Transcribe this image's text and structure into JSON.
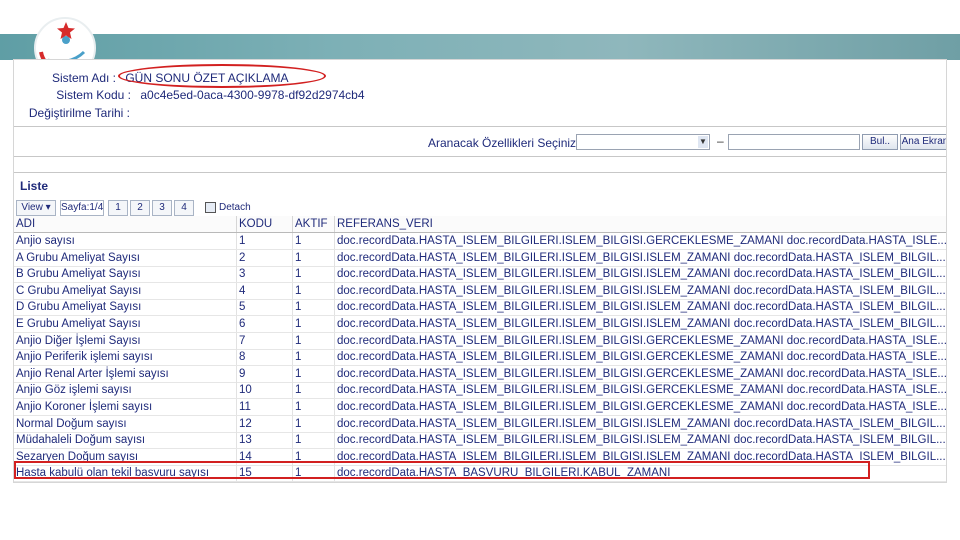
{
  "meta": {
    "system_name_label": "Sistem Adı :",
    "system_name_value": "GÜN SONU ÖZET AÇIKLAMA",
    "system_code_label": "Sistem Kodu :",
    "system_code_value": "a0c4e5ed-0aca-4300-9978-df92d2974cb4",
    "modified_date_label": "Değiştirilme Tarihi :"
  },
  "search": {
    "label": "Aranacak Özellikleri Seçiniz",
    "dash": "–",
    "find_button": "Bul..",
    "main_screen_button": "Ana Ekran"
  },
  "list": {
    "title": "Liste",
    "view_label": "View ▾",
    "page_label": "Sayfa:1/4",
    "pages": [
      "1",
      "2",
      "3",
      "4"
    ],
    "detach_label": "Detach"
  },
  "table": {
    "headers": [
      "ADI",
      "KODU",
      "AKTIF",
      "REFERANS_VERI"
    ],
    "rows": [
      [
        "Anjio sayısı",
        "1",
        "1",
        "doc.recordData.HASTA_ISLEM_BILGILERI.ISLEM_BILGISI.GERCEKLESME_ZAMANI doc.recordData.HASTA_ISLE..."
      ],
      [
        "A Grubu Ameliyat Sayısı",
        "2",
        "1",
        "doc.recordData.HASTA_ISLEM_BILGILERI.ISLEM_BILGISI.ISLEM_ZAMANI doc.recordData.HASTA_ISLEM_BILGIL..."
      ],
      [
        "B Grubu Ameliyat Sayısı",
        "3",
        "1",
        "doc.recordData.HASTA_ISLEM_BILGILERI.ISLEM_BILGISI.ISLEM_ZAMANI doc.recordData.HASTA_ISLEM_BILGIL..."
      ],
      [
        "C Grubu Ameliyat Sayısı",
        "4",
        "1",
        "doc.recordData.HASTA_ISLEM_BILGILERI.ISLEM_BILGISI.ISLEM_ZAMANI doc.recordData.HASTA_ISLEM_BILGIL..."
      ],
      [
        "D Grubu Ameliyat Sayısı",
        "5",
        "1",
        "doc.recordData.HASTA_ISLEM_BILGILERI.ISLEM_BILGISI.ISLEM_ZAMANI doc.recordData.HASTA_ISLEM_BILGIL..."
      ],
      [
        "E Grubu Ameliyat Sayısı",
        "6",
        "1",
        "doc.recordData.HASTA_ISLEM_BILGILERI.ISLEM_BILGISI.ISLEM_ZAMANI doc.recordData.HASTA_ISLEM_BILGIL..."
      ],
      [
        "Anjio Diğer İşlemi Sayısı",
        "7",
        "1",
        "doc.recordData.HASTA_ISLEM_BILGILERI.ISLEM_BILGISI.GERCEKLESME_ZAMANI doc.recordData.HASTA_ISLE..."
      ],
      [
        "Anjio Periferik işlemi sayısı",
        "8",
        "1",
        "doc.recordData.HASTA_ISLEM_BILGILERI.ISLEM_BILGISI.GERCEKLESME_ZAMANI doc.recordData.HASTA_ISLE..."
      ],
      [
        "Anjio Renal Arter İşlemi sayısı",
        "9",
        "1",
        "doc.recordData.HASTA_ISLEM_BILGILERI.ISLEM_BILGISI.GERCEKLESME_ZAMANI doc.recordData.HASTA_ISLE..."
      ],
      [
        "Anjio Göz işlemi sayısı",
        "10",
        "1",
        "doc.recordData.HASTA_ISLEM_BILGILERI.ISLEM_BILGISI.GERCEKLESME_ZAMANI doc.recordData.HASTA_ISLE..."
      ],
      [
        "Anjio Koroner İşlemi sayısı",
        "11",
        "1",
        "doc.recordData.HASTA_ISLEM_BILGILERI.ISLEM_BILGISI.GERCEKLESME_ZAMANI doc.recordData.HASTA_ISLE..."
      ],
      [
        "Normal Doğum sayısı",
        "12",
        "1",
        "doc.recordData.HASTA_ISLEM_BILGILERI.ISLEM_BILGISI.ISLEM_ZAMANI doc.recordData.HASTA_ISLEM_BILGIL..."
      ],
      [
        "Müdahaleli Doğum sayısı",
        "13",
        "1",
        "doc.recordData.HASTA_ISLEM_BILGILERI.ISLEM_BILGISI.ISLEM_ZAMANI doc.recordData.HASTA_ISLEM_BILGIL..."
      ],
      [
        "Sezaryen Doğum sayısı",
        "14",
        "1",
        "doc.recordData.HASTA_ISLEM_BILGILERI.ISLEM_BILGISI.ISLEM_ZAMANI doc.recordData.HASTA_ISLEM_BILGIL..."
      ],
      [
        "Hasta kabulü olan tekil basvuru sayısı",
        "15",
        "1",
        "doc.recordData.HASTA_BASVURU_BILGILERI.KABUL_ZAMANI"
      ]
    ]
  },
  "colors": {
    "accent_red": "#d22020",
    "text_blue": "#1f2a7a",
    "banner_teal": "#6fa6ad"
  }
}
